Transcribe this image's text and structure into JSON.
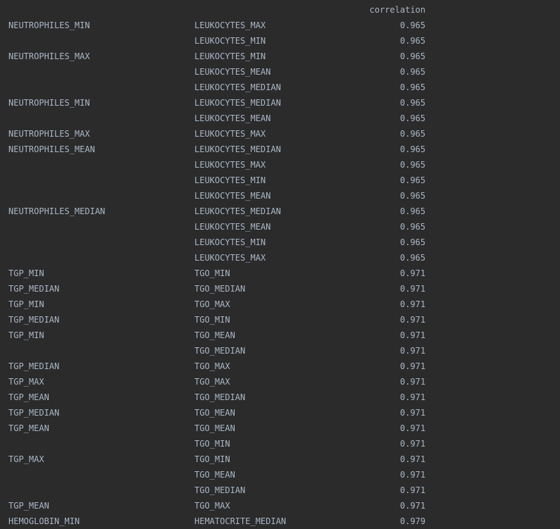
{
  "output": {
    "header": "correlation",
    "rows": [
      {
        "a": "NEUTROPHILES_MIN",
        "b": "LEUKOCYTES_MAX",
        "v": "0.965"
      },
      {
        "a": "",
        "b": "LEUKOCYTES_MIN",
        "v": "0.965"
      },
      {
        "a": "NEUTROPHILES_MAX",
        "b": "LEUKOCYTES_MIN",
        "v": "0.965"
      },
      {
        "a": "",
        "b": "LEUKOCYTES_MEAN",
        "v": "0.965"
      },
      {
        "a": "",
        "b": "LEUKOCYTES_MEDIAN",
        "v": "0.965"
      },
      {
        "a": "NEUTROPHILES_MIN",
        "b": "LEUKOCYTES_MEDIAN",
        "v": "0.965"
      },
      {
        "a": "",
        "b": "LEUKOCYTES_MEAN",
        "v": "0.965"
      },
      {
        "a": "NEUTROPHILES_MAX",
        "b": "LEUKOCYTES_MAX",
        "v": "0.965"
      },
      {
        "a": "NEUTROPHILES_MEAN",
        "b": "LEUKOCYTES_MEDIAN",
        "v": "0.965"
      },
      {
        "a": "",
        "b": "LEUKOCYTES_MAX",
        "v": "0.965"
      },
      {
        "a": "",
        "b": "LEUKOCYTES_MIN",
        "v": "0.965"
      },
      {
        "a": "",
        "b": "LEUKOCYTES_MEAN",
        "v": "0.965"
      },
      {
        "a": "NEUTROPHILES_MEDIAN",
        "b": "LEUKOCYTES_MEDIAN",
        "v": "0.965"
      },
      {
        "a": "",
        "b": "LEUKOCYTES_MEAN",
        "v": "0.965"
      },
      {
        "a": "",
        "b": "LEUKOCYTES_MIN",
        "v": "0.965"
      },
      {
        "a": "",
        "b": "LEUKOCYTES_MAX",
        "v": "0.965"
      },
      {
        "a": "TGP_MIN",
        "b": "TGO_MIN",
        "v": "0.971"
      },
      {
        "a": "TGP_MEDIAN",
        "b": "TGO_MEDIAN",
        "v": "0.971"
      },
      {
        "a": "TGP_MIN",
        "b": "TGO_MAX",
        "v": "0.971"
      },
      {
        "a": "TGP_MEDIAN",
        "b": "TGO_MIN",
        "v": "0.971"
      },
      {
        "a": "TGP_MIN",
        "b": "TGO_MEAN",
        "v": "0.971"
      },
      {
        "a": "",
        "b": "TGO_MEDIAN",
        "v": "0.971"
      },
      {
        "a": "TGP_MEDIAN",
        "b": "TGO_MAX",
        "v": "0.971"
      },
      {
        "a": "TGP_MAX",
        "b": "TGO_MAX",
        "v": "0.971"
      },
      {
        "a": "TGP_MEAN",
        "b": "TGO_MEDIAN",
        "v": "0.971"
      },
      {
        "a": "TGP_MEDIAN",
        "b": "TGO_MEAN",
        "v": "0.971"
      },
      {
        "a": "TGP_MEAN",
        "b": "TGO_MEAN",
        "v": "0.971"
      },
      {
        "a": "",
        "b": "TGO_MIN",
        "v": "0.971"
      },
      {
        "a": "TGP_MAX",
        "b": "TGO_MIN",
        "v": "0.971"
      },
      {
        "a": "",
        "b": "TGO_MEAN",
        "v": "0.971"
      },
      {
        "a": "",
        "b": "TGO_MEDIAN",
        "v": "0.971"
      },
      {
        "a": "TGP_MEAN",
        "b": "TGO_MAX",
        "v": "0.971"
      },
      {
        "a": "HEMOGLOBIN_MIN",
        "b": "HEMATOCRITE_MEDIAN",
        "v": "0.979"
      }
    ]
  }
}
